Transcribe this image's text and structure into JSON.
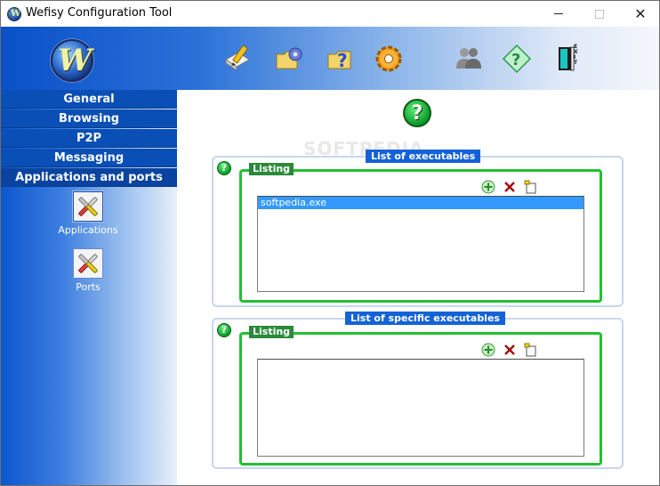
{
  "window": {
    "title": "Wefisy Configuration Tool",
    "app_icon_letter": "W"
  },
  "banner": {
    "logo_letter": "W",
    "exit_label": "EXIT"
  },
  "nav": {
    "items": [
      {
        "label": "General"
      },
      {
        "label": "Browsing"
      },
      {
        "label": "P2P"
      },
      {
        "label": "Messaging"
      },
      {
        "label": "Applications and ports"
      }
    ],
    "tiles": [
      {
        "label": "Applications"
      },
      {
        "label": "Ports"
      }
    ]
  },
  "content": {
    "help_symbol": "?",
    "watermark": "SOFTPEDIA",
    "groups": [
      {
        "title": "List of executables",
        "listing_label": "Listing",
        "rows": [
          "softpedia.exe"
        ]
      },
      {
        "title": "List of specific executables",
        "listing_label": "Listing",
        "rows": []
      }
    ]
  },
  "colors": {
    "accent": "#1462d8",
    "listing_border": "#22c032",
    "selection": "#3399ff"
  }
}
